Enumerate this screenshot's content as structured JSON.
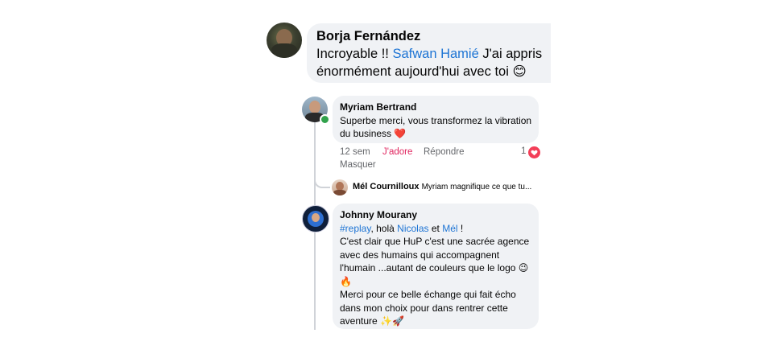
{
  "comments": {
    "borja": {
      "name": "Borja Fernández",
      "text_before": "Incroyable !! ",
      "mention": "Safwan Hamié",
      "text_after": " J'ai appris énormément aujourd'hui avec toi ",
      "emoji": "😊"
    },
    "myriam": {
      "name": "Myriam Bertrand",
      "text": "Superbe merci, vous transformez la vibration du business ",
      "emoji": "❤️",
      "time": "12 sem",
      "like_label": "J'adore",
      "reply_label": "Répondre",
      "hide_label": "Masquer",
      "reaction_count": "1"
    },
    "mel_reply": {
      "name": "Mél Cournilloux",
      "text": "Myriam magnifique ce que tu..."
    },
    "johnny": {
      "name": "Johnny Mourany",
      "hashtag": "#replay",
      "t1": ", holà ",
      "mention1": "Nicolas",
      "t2": " et ",
      "mention2": "Mél",
      "t3": " !",
      "para1": "C'est clair que HuP c'est une sacrée agence avec des humains qui accompagnent l'humain ...autant de couleurs que le logo ",
      "emoji1": "😉🔥",
      "para2": "Merci pour ce belle échange qui fait écho dans mon choix  pour dans rentrer cette aventure ",
      "emoji2": "✨🚀"
    }
  },
  "colors": {
    "bubble_bg": "#f0f2f5",
    "link": "#1d74d4",
    "like_red": "#e0245e",
    "meta_gray": "#65676b",
    "online": "#31a24c"
  },
  "icons": [
    "heart-reaction-icon",
    "online-status-icon"
  ]
}
